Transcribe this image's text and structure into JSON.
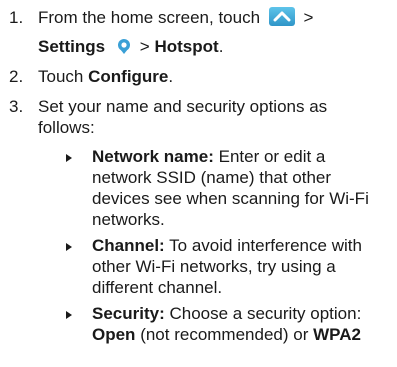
{
  "steps": [
    {
      "num": "1.",
      "line1_pre": "From the home screen, touch",
      "line1_post": ">",
      "settings_label": "Settings",
      "sep": ">",
      "hotspot_label": "Hotspot",
      "end": ".",
      "home_icon": "chevron-up-icon",
      "settings_icon": "location-pin-icon"
    },
    {
      "num": "2.",
      "pre": "Touch",
      "bold": "Configure",
      "end": "."
    },
    {
      "num": "3.",
      "line1": "Set your name and security options as",
      "line2": "follows:"
    }
  ],
  "bullets": [
    {
      "term": "Network name:",
      "lines": [
        "Enter or edit a",
        "network SSID (name) that other",
        "devices see when scanning for Wi-Fi",
        "networks."
      ]
    },
    {
      "term": "Channel:",
      "lines": [
        "To avoid interference with",
        "other Wi-Fi networks, try using a",
        "different channel."
      ]
    },
    {
      "term": "Security:",
      "line1": "Choose a security option:",
      "open_label": "Open",
      "open_note": "(not recommended) or",
      "wpa_label": "WPA2"
    }
  ],
  "colors": {
    "text": "#1a1a1a",
    "home_icon_top": "#5ec4ea",
    "home_icon_bottom": "#2f95c8",
    "settings_icon": "#3aa0d6"
  }
}
